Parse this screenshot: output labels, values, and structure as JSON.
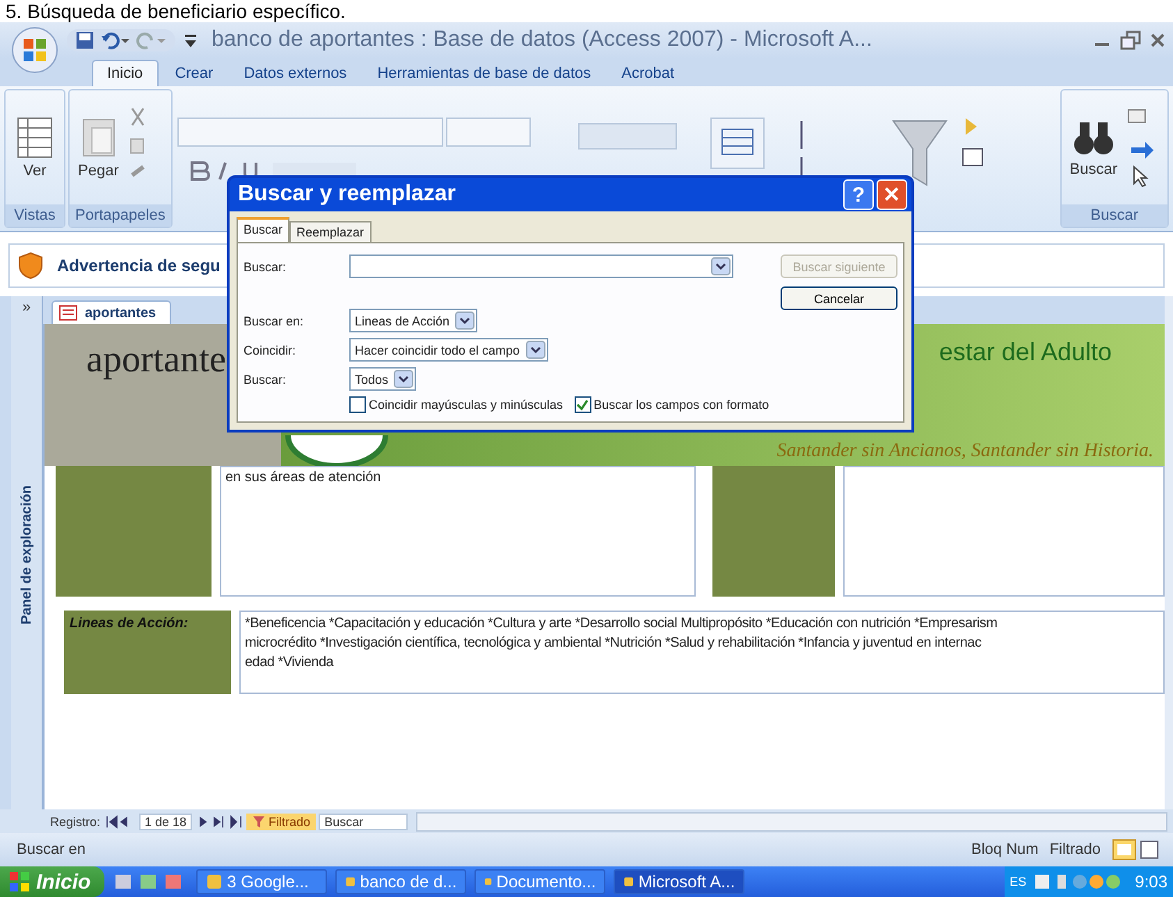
{
  "heading": "5. Búsqueda de beneficiario específico.",
  "window": {
    "title": "banco de aportantes : Base de datos (Access 2007) - Microsoft A..."
  },
  "ribbon_tabs": [
    {
      "label": "Inicio",
      "selected": true
    },
    {
      "label": "Crear",
      "selected": false
    },
    {
      "label": "Datos externos",
      "selected": false
    },
    {
      "label": "Herramientas de base de datos",
      "selected": false
    },
    {
      "label": "Acrobat",
      "selected": false
    }
  ],
  "ribbon_groups": [
    {
      "label": "Vistas",
      "button": "Ver"
    },
    {
      "label": "Portapapeles",
      "button": "Pegar"
    },
    {
      "label": "Buscar",
      "button": "Buscar"
    }
  ],
  "security_bar": {
    "text": "Advertencia de segu"
  },
  "nav_pane": {
    "expand": "»",
    "label": "Panel de exploración"
  },
  "document_tab": {
    "label": "aportantes"
  },
  "form": {
    "title": "aportante",
    "header_text": "estar del Adulto",
    "slogan": "Santander  sin Ancianos,  Santander sin Historia.",
    "field_value": "en sus áreas de atención",
    "lineas_label": "Lineas de Acción:",
    "lineas_lines": [
      "*Beneficencia *Capacitación y educación *Cultura y arte *Desarrollo social Multipropósito *Educación con nutrición *Empresarism",
      "microcrédito *Investigación científica, tecnológica y ambiental *Nutrición *Salud y rehabilitación *Infancia y juventud en internac",
      "edad *Vivienda"
    ]
  },
  "record_nav": {
    "label": "Registro:",
    "position": "1 de 18",
    "filter": "Filtrado",
    "search": "Buscar"
  },
  "status_bar": {
    "left": "Buscar en",
    "items": [
      "Bloq Num",
      "Filtrado"
    ]
  },
  "taskbar": {
    "start": "Inicio",
    "tasks": [
      {
        "label": "3 Google...",
        "selected": false
      },
      {
        "label": "banco de d...",
        "selected": false
      },
      {
        "label": "Documento...",
        "selected": false
      },
      {
        "label": "Microsoft A...",
        "selected": true
      }
    ],
    "language": "ES",
    "clock": "9:03"
  },
  "dialog": {
    "title": "Buscar y reemplazar",
    "help_button": "?",
    "close_button": "✕",
    "tabs": [
      {
        "label": "Buscar",
        "selected": true
      },
      {
        "label": "Reemplazar",
        "selected": false
      }
    ],
    "find": {
      "label": "Buscar:"
    },
    "selects": [
      {
        "label": "Buscar en:",
        "value": "Lineas de Acción"
      },
      {
        "label": "Coincidir:",
        "value": "Hacer coincidir todo el campo"
      },
      {
        "label": "Buscar:",
        "value": "Todos"
      }
    ],
    "checkboxes": [
      {
        "label": "Coincidir mayúsculas y minúsculas",
        "checked": false
      },
      {
        "label": "Buscar los campos con formato",
        "checked": true
      }
    ],
    "buttons": [
      {
        "label": "Buscar siguiente",
        "disabled": true
      },
      {
        "label": "Cancelar",
        "disabled": false
      }
    ]
  }
}
